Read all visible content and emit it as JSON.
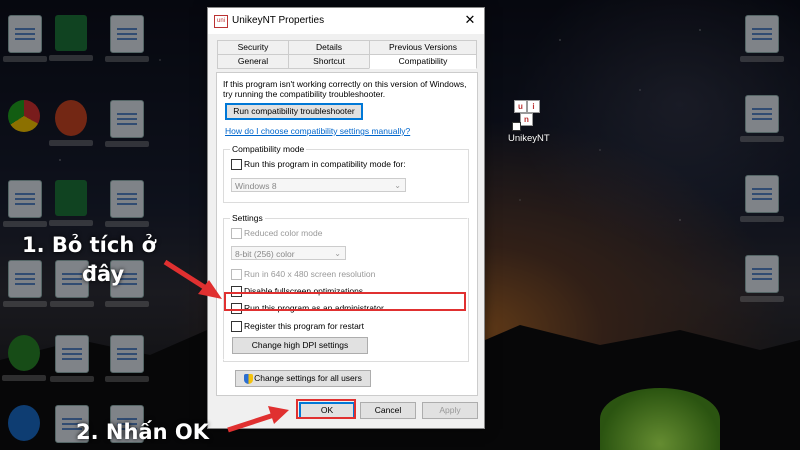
{
  "desktop_icon": {
    "label": "UnikeyNT",
    "letters": [
      "u",
      "n",
      "i"
    ]
  },
  "dialog": {
    "title": "UnikeyNT Properties",
    "close": "✕",
    "tabs_row1": [
      "Security",
      "Details",
      "Previous Versions"
    ],
    "tabs_row2": [
      "General",
      "Shortcut",
      "Compatibility"
    ],
    "active_tab": "Compatibility",
    "intro_line1": "If this program isn't working correctly on this version of Windows,",
    "intro_line2": "try running the compatibility troubleshooter.",
    "troubleshooter_button": "Run compatibility troubleshooter",
    "help_link": "How do I choose compatibility settings manually?",
    "compat_mode": {
      "group_title": "Compatibility mode",
      "checkbox_label": "Run this program in compatibility mode for:",
      "checked": false,
      "select_value": "Windows 8"
    },
    "settings": {
      "group_title": "Settings",
      "reduced_color": {
        "label": "Reduced color mode",
        "checked": false,
        "disabled": true
      },
      "color_select": "8-bit (256) color",
      "run_640": {
        "label": "Run in 640 x 480 screen resolution",
        "checked": false,
        "disabled": true
      },
      "disable_fullscreen": {
        "label": "Disable fullscreen optimizations",
        "checked": false
      },
      "run_admin": {
        "label": "Run this program as an administrator",
        "checked": false
      },
      "register_restart": {
        "label": "Register this program for restart",
        "checked": false
      },
      "dpi_button": "Change high DPI settings"
    },
    "all_users_button": "Change settings for all users",
    "ok_button": "OK",
    "cancel_button": "Cancel",
    "apply_button": "Apply"
  },
  "annotations": {
    "step1_line1": "1. Bỏ tích ở",
    "step1_line2": "đây",
    "step2": "2. Nhấn OK",
    "color": "#e03030"
  }
}
